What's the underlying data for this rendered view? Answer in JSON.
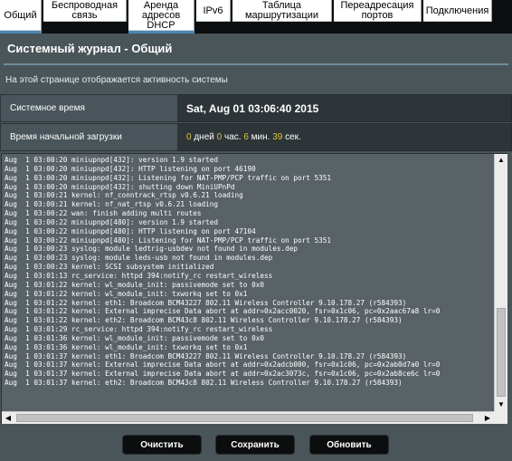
{
  "tabs": [
    {
      "label": "Общий",
      "active": true
    },
    {
      "label": "Беспроводная связь",
      "active": false
    },
    {
      "label": "Аренда адресов DHCP",
      "active": false
    },
    {
      "label": "IPv6",
      "active": false
    },
    {
      "label": "Таблица маршрутизации",
      "active": false
    },
    {
      "label": "Переадресация портов",
      "active": false
    },
    {
      "label": "Подключения",
      "active": false
    }
  ],
  "page": {
    "title": "Системный журнал - Общий",
    "description": "На этой странице отображается активность системы"
  },
  "info": {
    "system_time_label": "Системное время",
    "system_time_value": "Sat, Aug 01 03:06:40 2015",
    "uptime_label": "Время начальной загрузки",
    "uptime": {
      "days": "0",
      "days_unit": "дней",
      "hours": "0",
      "hours_unit": "час.",
      "minutes": "6",
      "minutes_unit": "мин.",
      "seconds": "39",
      "seconds_unit": "сек."
    }
  },
  "log_lines": [
    "Aug  1 03:00:20 miniupnpd[432]: version 1.9 started",
    "Aug  1 03:00:20 miniupnpd[432]: HTTP listening on port 46190",
    "Aug  1 03:00:20 miniupnpd[432]: Listening for NAT-PMP/PCP traffic on port 5351",
    "Aug  1 03:00:20 miniupnpd[432]: shutting down MiniUPnPd",
    "Aug  1 03:00:21 kernel: nf_conntrack_rtsp v0.6.21 loading",
    "Aug  1 03:00:21 kernel: nf_nat_rtsp v0.6.21 loading",
    "Aug  1 03:00:22 wan: finish adding multi routes",
    "Aug  1 03:00:22 miniupnpd[480]: version 1.9 started",
    "Aug  1 03:00:22 miniupnpd[480]: HTTP listening on port 47104",
    "Aug  1 03:00:22 miniupnpd[480]: Listening for NAT-PMP/PCP traffic on port 5351",
    "Aug  1 03:00:23 syslog: module ledtrig-usbdev not found in modules.dep",
    "Aug  1 03:00:23 syslog: module leds-usb not found in modules.dep",
    "Aug  1 03:00:23 kernel: SCSI subsystem initialized",
    "Aug  1 03:01:13 rc_service: httpd 394:notify_rc restart_wireless",
    "Aug  1 03:01:22 kernel: wl_module_init: passivemode set to 0x0",
    "Aug  1 03:01:22 kernel: wl_module_init: txworkq set to 0x1",
    "Aug  1 03:01:22 kernel: eth1: Broadcom BCM43227 802.11 Wireless Controller 9.10.178.27 (r584393)",
    "Aug  1 03:01:22 kernel: External imprecise Data abort at addr=0x2acc0020, fsr=0x1c06, pc=0x2aac67a8 lr=0",
    "Aug  1 03:01:22 kernel: eth2: Broadcom BCM43c8 802.11 Wireless Controller 9.10.178.27 (r584393)",
    "Aug  1 03:01:29 rc_service: httpd 394:notify_rc restart_wireless",
    "Aug  1 03:01:36 kernel: wl_module_init: passivemode set to 0x0",
    "Aug  1 03:01:36 kernel: wl_module_init: txworkq set to 0x1",
    "Aug  1 03:01:37 kernel: eth1: Broadcom BCM43227 802.11 Wireless Controller 9.10.178.27 (r584393)",
    "Aug  1 03:01:37 kernel: External imprecise Data abort at addr=0x2adcb000, fsr=0x1c06, pc=0x2ab0d7a0 lr=0",
    "Aug  1 03:01:37 kernel: External imprecise Data abort at addr=0x2ac3073c, fsr=0x1c06, pc=0x2ab8ce6c lr=0",
    "Aug  1 03:01:37 kernel: eth2: Broadcom BCM43c8 802.11 Wireless Controller 9.10.178.27 (r584393)"
  ],
  "scroll": {
    "up_glyph": "▲",
    "down_glyph": "▼",
    "left_glyph": "◀",
    "right_glyph": "▶"
  },
  "buttons": {
    "clear": "Очистить",
    "save": "Сохранить",
    "refresh": "Обновить"
  },
  "colors": {
    "accent_number": "#e1c442",
    "active_tab_underline": "#4a88b4"
  }
}
